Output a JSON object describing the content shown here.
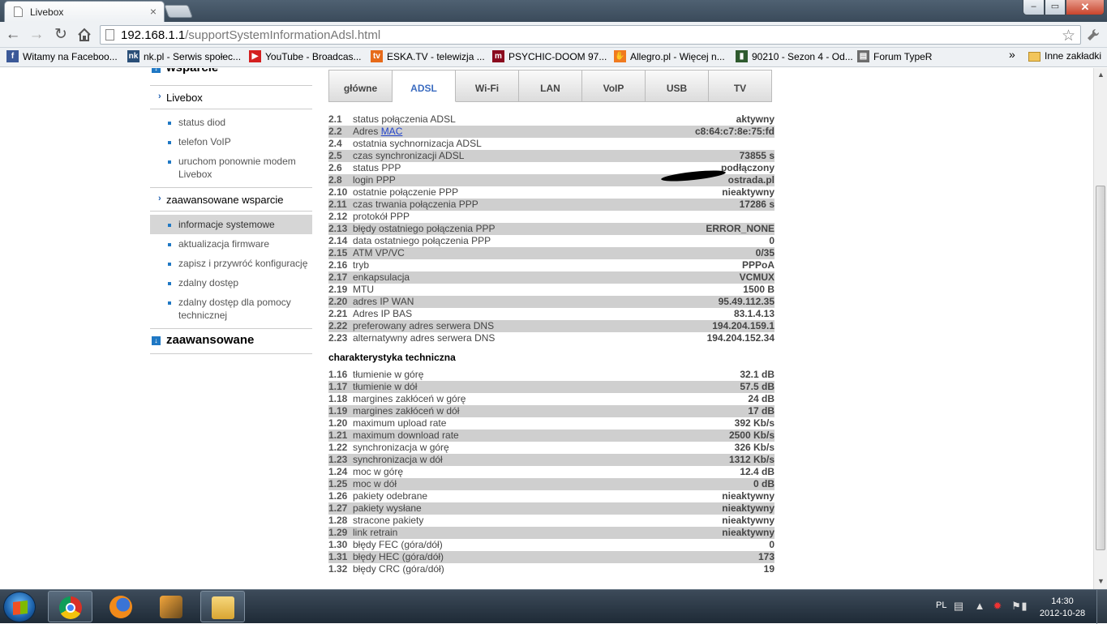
{
  "browser": {
    "tab_title": "Livebox",
    "tab_close": "×",
    "url_host": "192.168.1.1",
    "url_path": "/supportSystemInformationAdsl.html",
    "window_min": "–",
    "window_max": "▭",
    "window_close": "✕"
  },
  "bookmarks": [
    {
      "label": "Witamy na Faceboo...",
      "icon": "facebook-icon",
      "color": "#3b5998",
      "glyph": "f"
    },
    {
      "label": "nk.pl - Serwis społec...",
      "icon": "nk-icon",
      "color": "#2a4f78",
      "glyph": "nk"
    },
    {
      "label": "YouTube - Broadcas...",
      "icon": "youtube-icon",
      "color": "#d42020",
      "glyph": "▶"
    },
    {
      "label": "ESKA.TV - telewizja ...",
      "icon": "eskatv-icon",
      "color": "#e66a1a",
      "glyph": "tv"
    },
    {
      "label": "PSYCHIC-DOOM 97...",
      "icon": "psychic-icon",
      "color": "#8a0a1e",
      "glyph": "m"
    },
    {
      "label": "Allegro.pl - Więcej n...",
      "icon": "allegro-icon",
      "color": "#f07a20",
      "glyph": "✋"
    },
    {
      "label": "90210 - Sezon 4 - Od...",
      "icon": "film-icon",
      "color": "#2e5a2e",
      "glyph": "▮"
    },
    {
      "label": "Forum TypeR",
      "icon": "forum-icon",
      "color": "#6d6d6d",
      "glyph": "▤"
    }
  ],
  "bookmarks_more": "»",
  "bookmarks_other": "Inne zakładki",
  "sidebar": {
    "wsparcie": "wsparcie",
    "livebox": "Livebox",
    "livebox_items": [
      "status diod",
      "telefon VoIP",
      "uruchom ponownie modem Livebox"
    ],
    "zaaw_wsparcie": "zaawansowane wsparcie",
    "zaaw_items": [
      "informacje systemowe",
      "aktualizacja firmware",
      "zapisz i przywróć konfigurację",
      "zdalny dostęp",
      "zdalny dostęp dla pomocy technicznej"
    ],
    "zaawansowane": "zaawansowane"
  },
  "tabs": [
    "główne",
    "ADSL",
    "Wi-Fi",
    "LAN",
    "VoIP",
    "USB",
    "TV"
  ],
  "adsl_rows": [
    {
      "num": "2.1",
      "label": "status połączenia ADSL",
      "value": "aktywny"
    },
    {
      "num": "2.2",
      "label": "Adres ",
      "link": "MAC",
      "value": "c8:64:c7:8e:75:fd"
    },
    {
      "num": "2.4",
      "label": "ostatnia sychnornizacja ADSL",
      "value": ""
    },
    {
      "num": "2.5",
      "label": "czas synchronizacji ADSL",
      "value": "73855 s"
    },
    {
      "num": "2.6",
      "label": "status PPP",
      "value": "podłączony"
    },
    {
      "num": "2.8",
      "label": "login PPP",
      "value": "ostrada.pl"
    },
    {
      "num": "2.10",
      "label": "ostatnie połączenie PPP",
      "value": "nieaktywny"
    },
    {
      "num": "2.11",
      "label": "czas trwania połączenia PPP",
      "value": "17286 s"
    },
    {
      "num": "2.12",
      "label": "protokół PPP",
      "value": ""
    },
    {
      "num": "2.13",
      "label": "błędy ostatniego połączenia PPP",
      "value": "ERROR_NONE"
    },
    {
      "num": "2.14",
      "label": "data ostatniego połączenia PPP",
      "value": "0"
    },
    {
      "num": "2.15",
      "label": "ATM VP/VC",
      "value": "0/35"
    },
    {
      "num": "2.16",
      "label": "tryb",
      "value": "PPPoA"
    },
    {
      "num": "2.17",
      "label": "enkapsulacja",
      "value": "VCMUX"
    },
    {
      "num": "2.19",
      "label": "MTU",
      "value": "1500 B"
    },
    {
      "num": "2.20",
      "label": "adres IP WAN",
      "value": "95.49.112.35"
    },
    {
      "num": "2.21",
      "label": "Adres IP BAS",
      "value": "83.1.4.13"
    },
    {
      "num": "2.22",
      "label": "preferowany adres serwera DNS",
      "value": "194.204.159.1"
    },
    {
      "num": "2.23",
      "label": "alternatywny adres serwera DNS",
      "value": "194.204.152.34"
    }
  ],
  "tech_title": "charakterystyka techniczna",
  "tech_rows": [
    {
      "num": "1.16",
      "label": "tłumienie w górę",
      "value": "32.1 dB"
    },
    {
      "num": "1.17",
      "label": "tłumienie w dół",
      "value": "57.5 dB"
    },
    {
      "num": "1.18",
      "label": "margines zakłóceń w górę",
      "value": "24 dB"
    },
    {
      "num": "1.19",
      "label": "margines zakłóceń w dół",
      "value": "17 dB"
    },
    {
      "num": "1.20",
      "label": "maximum upload rate",
      "value": "392 Kb/s"
    },
    {
      "num": "1.21",
      "label": "maximum download rate",
      "value": "2500 Kb/s"
    },
    {
      "num": "1.22",
      "label": "synchronizacja w górę",
      "value": "326 Kb/s"
    },
    {
      "num": "1.23",
      "label": "synchronizacja w dół",
      "value": "1312 Kb/s"
    },
    {
      "num": "1.24",
      "label": "moc w górę",
      "value": "12.4 dB"
    },
    {
      "num": "1.25",
      "label": "moc w dół",
      "value": "0 dB"
    },
    {
      "num": "1.26",
      "label": "pakiety odebrane",
      "value": "nieaktywny"
    },
    {
      "num": "1.27",
      "label": "pakiety wysłane",
      "value": "nieaktywny"
    },
    {
      "num": "1.28",
      "label": "stracone pakiety",
      "value": "nieaktywny"
    },
    {
      "num": "1.29",
      "label": "link retrain",
      "value": "nieaktywny"
    },
    {
      "num": "1.30",
      "label": "błędy FEC (góra/dół)",
      "value": "0"
    },
    {
      "num": "1.31",
      "label": "błędy HEC (góra/dół)",
      "value": "173"
    },
    {
      "num": "1.32",
      "label": "błędy CRC (góra/dół)",
      "value": "19"
    }
  ],
  "taskbar": {
    "lang": "PL",
    "time": "14:30",
    "date": "2012-10-28"
  }
}
